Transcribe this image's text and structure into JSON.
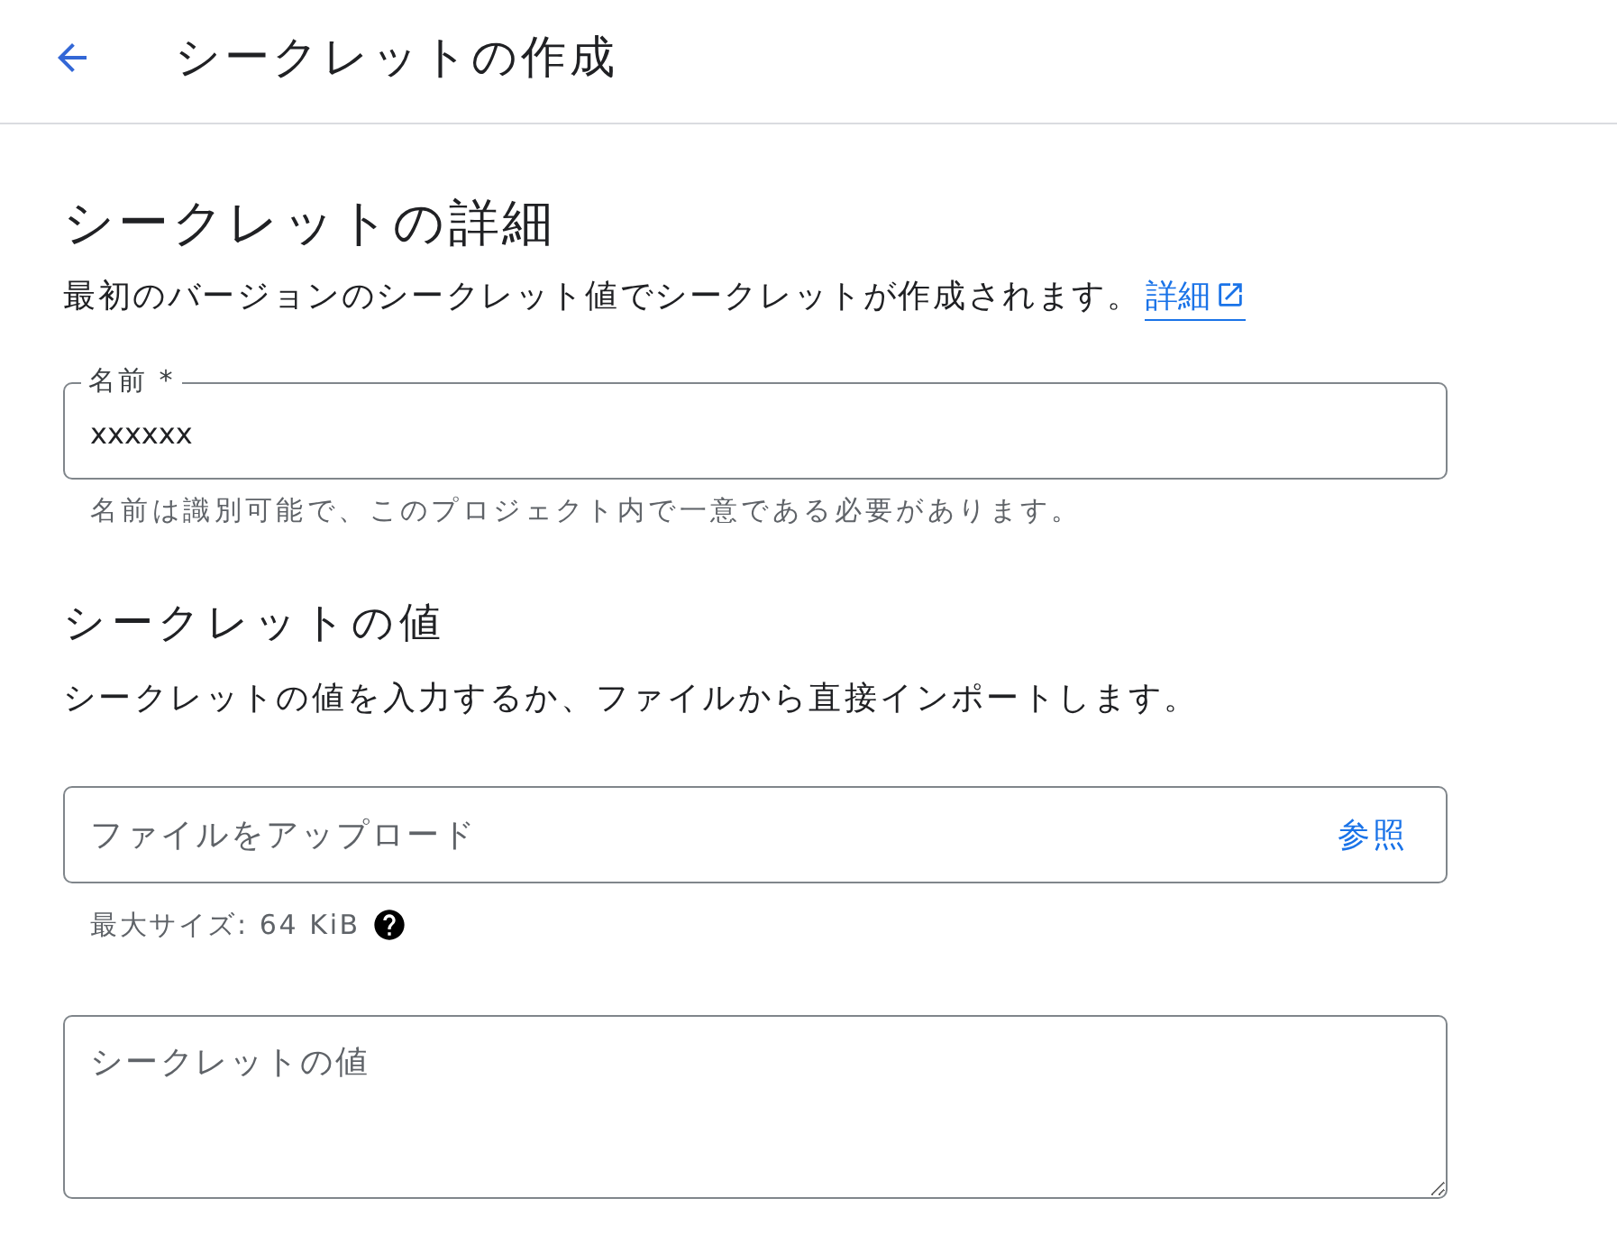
{
  "header": {
    "title": "シークレットの作成"
  },
  "details": {
    "heading": "シークレットの詳細",
    "description": "最初のバージョンのシークレット値でシークレットが作成されます。",
    "link": "詳細",
    "name_field": {
      "label": "名前 *",
      "value": "xxxxxx",
      "helper": "名前は識別可能で、このプロジェクト内で一意である必要があります。"
    }
  },
  "value_section": {
    "heading": "シークレットの値",
    "description": "シークレットの値を入力するか、ファイルから直接インポートします。",
    "upload_field": {
      "placeholder": "ファイルをアップロード",
      "browse": "参照",
      "helper": "最大サイズ: 64 KiB"
    },
    "value_field": {
      "placeholder": "シークレットの値"
    }
  }
}
